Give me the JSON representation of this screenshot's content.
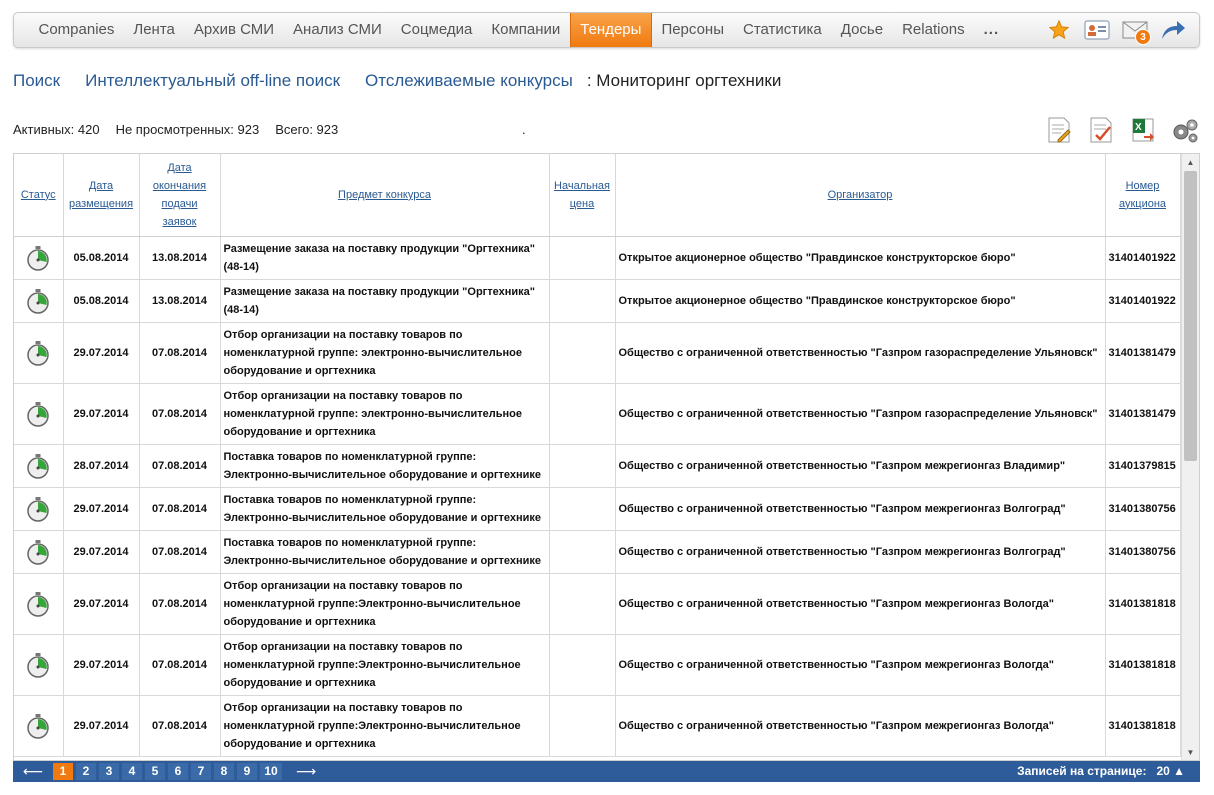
{
  "nav": {
    "items": [
      "Companies",
      "Лента",
      "Архив СМИ",
      "Анализ СМИ",
      "Соцмедиа",
      "Компании",
      "Тендеры",
      "Персоны",
      "Статистика",
      "Досье",
      "Relations",
      "..."
    ],
    "active_index": 6,
    "mail_badge": "3",
    "accent": "#f07a10"
  },
  "breadcrumbs": {
    "links": [
      "Поиск",
      "Интеллектуальный off-line поиск",
      "Отслеживаемые конкурсы"
    ],
    "current": ": Мониторинг оргтехники"
  },
  "stats": {
    "active": "Активных: 420",
    "unseen": "Не просмотренных: 923",
    "total": "Всего: 923",
    "dot": "."
  },
  "table": {
    "headers": {
      "status": "Статус",
      "date_posted_1": "Дата",
      "date_posted_2": "размещения",
      "date_end_1": "Дата",
      "date_end_2": "окончания",
      "date_end_3": "подачи",
      "date_end_4": "заявок",
      "subject": "Предмет конкурса",
      "price_1": "Начальная",
      "price_2": "цена",
      "organizer": "Организатор",
      "auction_1": "Номер",
      "auction_2": "аукциона"
    },
    "rows": [
      {
        "posted": "05.08.2014",
        "end": "13.08.2014",
        "subject": "Размещение заказа на поставку продукции \"Оргтехника\" (48-14)",
        "price": "",
        "organizer": "Открытое акционерное общество \"Правдинское конструкторское бюро\"",
        "number": "31401401922"
      },
      {
        "posted": "05.08.2014",
        "end": "13.08.2014",
        "subject": "Размещение заказа на поставку продукции \"Оргтехника\" (48-14)",
        "price": "",
        "organizer": "Открытое акционерное общество \"Правдинское конструкторское бюро\"",
        "number": "31401401922"
      },
      {
        "posted": "29.07.2014",
        "end": "07.08.2014",
        "subject": "Отбор организации на поставку товаров по номенклатурной группе: электронно-вычислительное оборудование и оргтехника",
        "price": "",
        "organizer": "Общество с ограниченной ответственностью \"Газпром газораспределение Ульяновск\"",
        "number": "31401381479"
      },
      {
        "posted": "29.07.2014",
        "end": "07.08.2014",
        "subject": "Отбор организации на поставку товаров по номенклатурной группе: электронно-вычислительное оборудование и оргтехника",
        "price": "",
        "organizer": "Общество с ограниченной ответственностью \"Газпром газораспределение Ульяновск\"",
        "number": "31401381479"
      },
      {
        "posted": "28.07.2014",
        "end": "07.08.2014",
        "subject": "Поставка товаров по номенклатурной группе: Электронно-вычислительное оборудование и оргтехнике",
        "price": "",
        "organizer": "Общество с ограниченной ответственностью \"Газпром межрегионгаз Владимир\"",
        "number": "31401379815"
      },
      {
        "posted": "29.07.2014",
        "end": "07.08.2014",
        "subject": "Поставка товаров по номенклатурной группе: Электронно-вычислительное оборудование и оргтехнике",
        "price": "",
        "organizer": "Общество с ограниченной ответственностью \"Газпром межрегионгаз Волгоград\"",
        "number": "31401380756"
      },
      {
        "posted": "29.07.2014",
        "end": "07.08.2014",
        "subject": "Поставка товаров по номенклатурной группе: Электронно-вычислительное оборудование и оргтехнике",
        "price": "",
        "organizer": "Общество с ограниченной ответственностью \"Газпром межрегионгаз Волгоград\"",
        "number": "31401380756"
      },
      {
        "posted": "29.07.2014",
        "end": "07.08.2014",
        "subject": "Отбор организации на поставку товаров по номенклатурной группе:Электронно-вычислительное оборудование и оргтехника",
        "price": "",
        "organizer": "Общество с ограниченной ответственностью \"Газпром межрегионгаз Вологда\"",
        "number": "31401381818"
      },
      {
        "posted": "29.07.2014",
        "end": "07.08.2014",
        "subject": "Отбор организации на поставку товаров по номенклатурной группе:Электронно-вычислительное оборудование и оргтехника",
        "price": "",
        "organizer": "Общество с ограниченной ответственностью \"Газпром межрегионгаз Вологда\"",
        "number": "31401381818"
      },
      {
        "posted": "29.07.2014",
        "end": "07.08.2014",
        "subject": "Отбор организации на поставку товаров по номенклатурной группе:Электронно-вычислительное оборудование и оргтехника",
        "price": "",
        "organizer": "Общество с ограниченной ответственностью \"Газпром межрегионгаз Вологда\"",
        "number": "31401381818"
      }
    ]
  },
  "pager": {
    "pages": [
      "1",
      "2",
      "3",
      "4",
      "5",
      "6",
      "7",
      "8",
      "9",
      "10"
    ],
    "active": "1",
    "prev": "⟵",
    "next": "⟶",
    "per_page_label": "Записей на странице:",
    "per_page_value": "20 ▲"
  }
}
